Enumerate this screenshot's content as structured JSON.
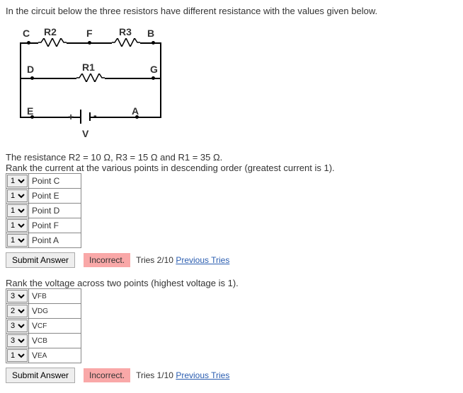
{
  "intro": "In the circuit below the three resistors have different resistance with the values given below.",
  "circuit_labels": {
    "C": "C",
    "R2": "R2",
    "F": "F",
    "R3": "R3",
    "B": "B",
    "D": "D",
    "R1": "R1",
    "G": "G",
    "E": "E",
    "A": "A",
    "V": "V",
    "plus": "+",
    "minus": "-"
  },
  "given": "The resistance R2 = 10 Ω, R3 = 15 Ω and R1 = 35 Ω.",
  "q1": {
    "prompt": "Rank the current at the various points in descending order (greatest current is 1).",
    "rows": [
      {
        "sel": "1",
        "label": "Point C"
      },
      {
        "sel": "1",
        "label": "Point E"
      },
      {
        "sel": "1",
        "label": "Point D"
      },
      {
        "sel": "1",
        "label": "Point F"
      },
      {
        "sel": "1",
        "label": "Point A"
      }
    ],
    "submit": "Submit Answer",
    "status": "Incorrect.",
    "tries": "Tries 2/10",
    "prev": "Previous Tries"
  },
  "q2": {
    "prompt": "Rank the voltage across two points (highest voltage is 1).",
    "rows": [
      {
        "sel": "3",
        "main": "V",
        "sub": "FB"
      },
      {
        "sel": "2",
        "main": "V",
        "sub": "DG"
      },
      {
        "sel": "3",
        "main": "V",
        "sub": "CF"
      },
      {
        "sel": "3",
        "main": "V",
        "sub": "CB"
      },
      {
        "sel": "1",
        "main": "V",
        "sub": "EA"
      }
    ],
    "submit": "Submit Answer",
    "status": "Incorrect.",
    "tries": "Tries 1/10",
    "prev": "Previous Tries"
  }
}
